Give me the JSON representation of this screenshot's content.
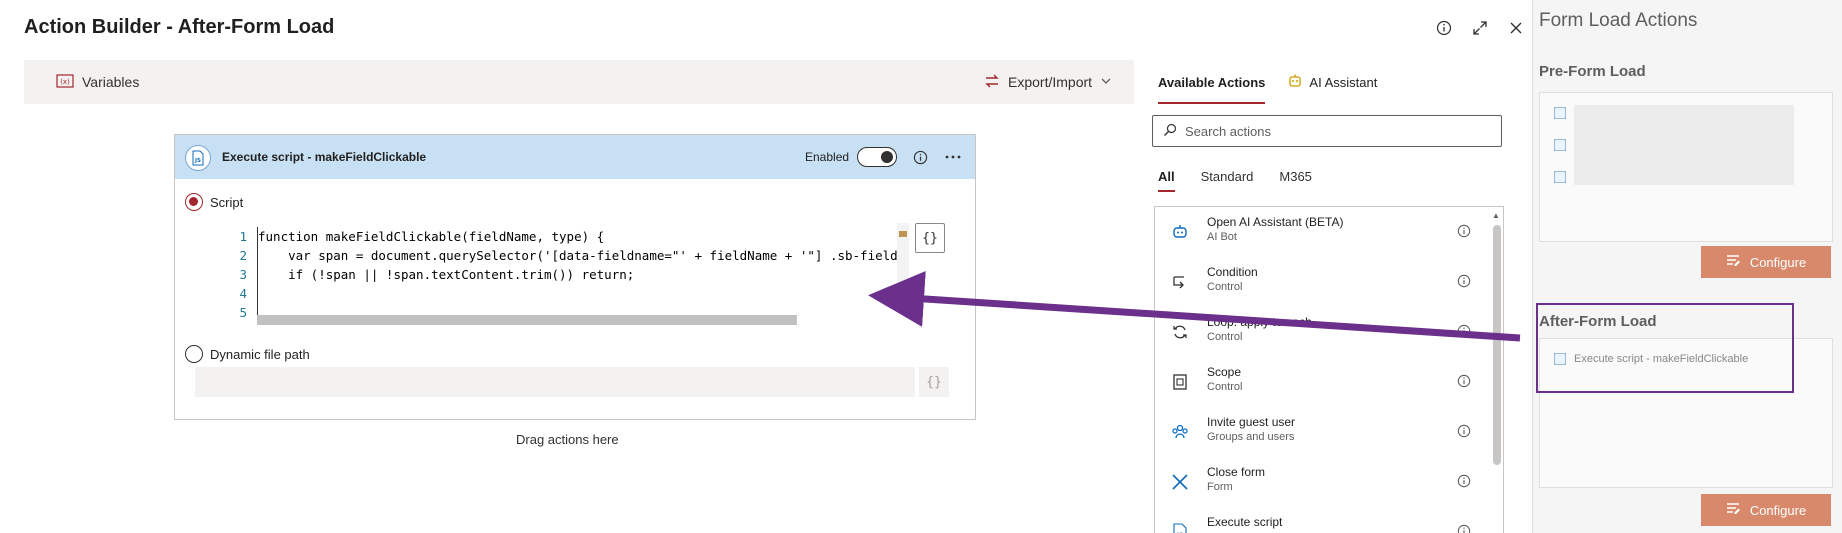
{
  "dialog": {
    "title": "Action Builder - After-Form Load",
    "toolbar": {
      "variables_label": "Variables",
      "export_label": "Export/Import"
    },
    "drag_hint": "Drag actions here"
  },
  "script_card": {
    "title": "Execute script - makeFieldClickable",
    "enabled_label": "Enabled",
    "script_option": "Script",
    "dynamic_option": "Dynamic file path",
    "brace_label": "{}",
    "line_numbers": [
      "1",
      "2",
      "3",
      "4",
      "5"
    ],
    "code_lines": [
      "function makeFieldClickable(fieldName, type) {",
      "    var span = document.querySelector('[data-fieldname=\"' + fieldName + '\"] .sb-field",
      "    if (!span || !span.textContent.trim()) return;",
      "",
      "    "
    ]
  },
  "actions_panel": {
    "tabs": [
      "Available Actions",
      "AI Assistant"
    ],
    "search_placeholder": "Search actions",
    "filters": [
      "All",
      "Standard",
      "M365"
    ],
    "items": [
      {
        "name": "Open AI Assistant (BETA)",
        "category": "AI Bot",
        "icon": "ai-bot-icon"
      },
      {
        "name": "Condition",
        "category": "Control",
        "icon": "condition-icon"
      },
      {
        "name": "Loop: apply to each",
        "category": "Control",
        "icon": "loop-icon"
      },
      {
        "name": "Scope",
        "category": "Control",
        "icon": "scope-icon"
      },
      {
        "name": "Invite guest user",
        "category": "Groups and users",
        "icon": "invite-user-icon"
      },
      {
        "name": "Close form",
        "category": "Form",
        "icon": "close-form-icon"
      },
      {
        "name": "Execute script",
        "category": "",
        "icon": "js-icon"
      }
    ]
  },
  "form_load_panel": {
    "title": "Form Load Actions",
    "pre_section": "Pre-Form Load",
    "after_section": "After-Form Load",
    "after_item": "Execute script - makeFieldClickable",
    "configure_label": "Configure"
  },
  "colors": {
    "accent": "#a4262c",
    "card_header": "#c7e0f4",
    "configure": "#d9896b",
    "arrow": "#6b2f8c"
  }
}
